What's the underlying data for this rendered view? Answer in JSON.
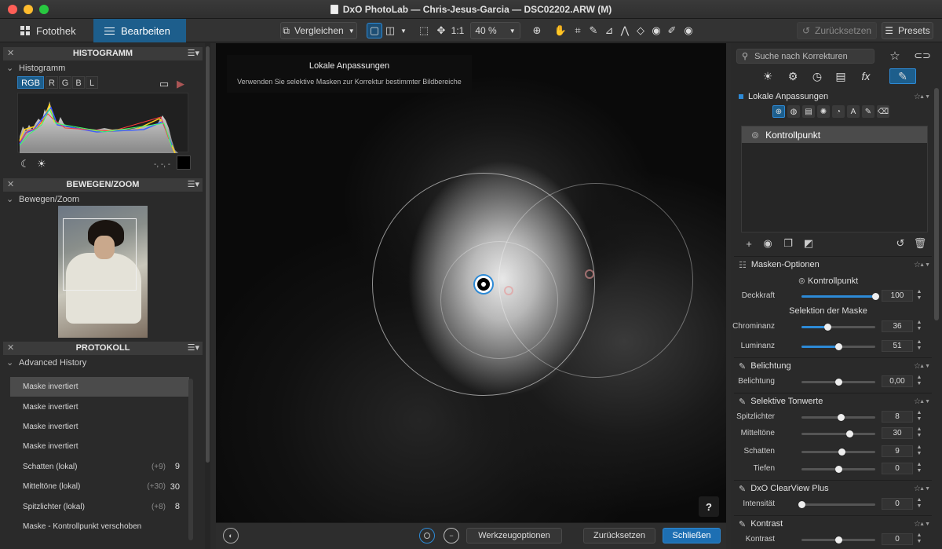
{
  "window": {
    "title": "DxO PhotoLab — Chris-Jesus-Garcia — DSC02202.ARW (M)"
  },
  "toolbar": {
    "tab_fotothek": "Fotothek",
    "tab_bearbeiten": "Bearbeiten",
    "compare_label": "Vergleichen",
    "zoom_one": "1:1",
    "zoom_value": "40 %",
    "reset_label": "Zurücksetzen",
    "presets_label": "Presets"
  },
  "left": {
    "histogram": {
      "header": "HISTOGRAMM",
      "subheader": "Histogramm",
      "channels": [
        "RGB",
        "R",
        "G",
        "B",
        "L"
      ],
      "selected_channel": "RGB",
      "readout": "-, -, -"
    },
    "move_zoom": {
      "header": "BEWEGEN/ZOOM",
      "subheader": "Bewegen/Zoom"
    },
    "protocol": {
      "header": "PROTOKOLL",
      "subheader": "Advanced History",
      "items": [
        {
          "label": "Maske invertiert",
          "delta": "",
          "value": ""
        },
        {
          "label": "Maske invertiert",
          "delta": "",
          "value": ""
        },
        {
          "label": "Maske invertiert",
          "delta": "",
          "value": ""
        },
        {
          "label": "Maske invertiert",
          "delta": "",
          "value": ""
        },
        {
          "label": "Schatten (lokal)",
          "delta": "(+9)",
          "value": "9"
        },
        {
          "label": "Mitteltöne (lokal)",
          "delta": "(+30)",
          "value": "30"
        },
        {
          "label": "Spitzlichter (lokal)",
          "delta": "(+8)",
          "value": "8"
        },
        {
          "label": "Maske - Kontrollpunkt verschoben",
          "delta": "",
          "value": ""
        }
      ]
    }
  },
  "canvas": {
    "tooltip_title": "Lokale Anpassungen",
    "tooltip_desc": "Verwenden Sie selektive Masken zur Korrektur bestimmter Bildbereiche",
    "help": "?"
  },
  "bottom": {
    "werkzeug": "Werkzeugoptionen",
    "reset": "Zurücksetzen",
    "close": "Schließen"
  },
  "right": {
    "search_placeholder": "Suche nach Korrekturen",
    "local_adjust": {
      "title": "Lokale Anpassungen",
      "mask_item": "Kontrollpunkt"
    },
    "mask_options": {
      "title": "Masken-Optionen",
      "type": "Kontrollpunkt",
      "opacity": {
        "label": "Deckkraft",
        "value": "100",
        "level": 1.0
      },
      "selection_title": "Selektion der Maske",
      "chrominance": {
        "label": "Chrominanz",
        "value": "36",
        "level": 0.36
      },
      "luminance": {
        "label": "Luminanz",
        "value": "51",
        "level": 0.51
      }
    },
    "exposure": {
      "title": "Belichtung",
      "label": "Belichtung",
      "value": "0,00",
      "level": 0.5
    },
    "selective_tones": {
      "title": "Selektive Tonwerte",
      "highlights": {
        "label": "Spitzlichter",
        "value": "8",
        "level": 0.54
      },
      "midtones": {
        "label": "Mitteltöne",
        "value": "30",
        "level": 0.65
      },
      "shadows": {
        "label": "Schatten",
        "value": "9",
        "level": 0.545
      },
      "blacks": {
        "label": "Tiefen",
        "value": "0",
        "level": 0.5
      }
    },
    "clearview": {
      "title": "DxO ClearView Plus",
      "label": "Intensität",
      "value": "0",
      "level": 0.0
    },
    "contrast": {
      "title": "Kontrast",
      "label": "Kontrast",
      "value": "0",
      "level": 0.5
    }
  },
  "colors": {
    "accent": "#1d5e8c",
    "slider_fill": "#2d8ad6",
    "primary_button": "#1d6fb3"
  }
}
